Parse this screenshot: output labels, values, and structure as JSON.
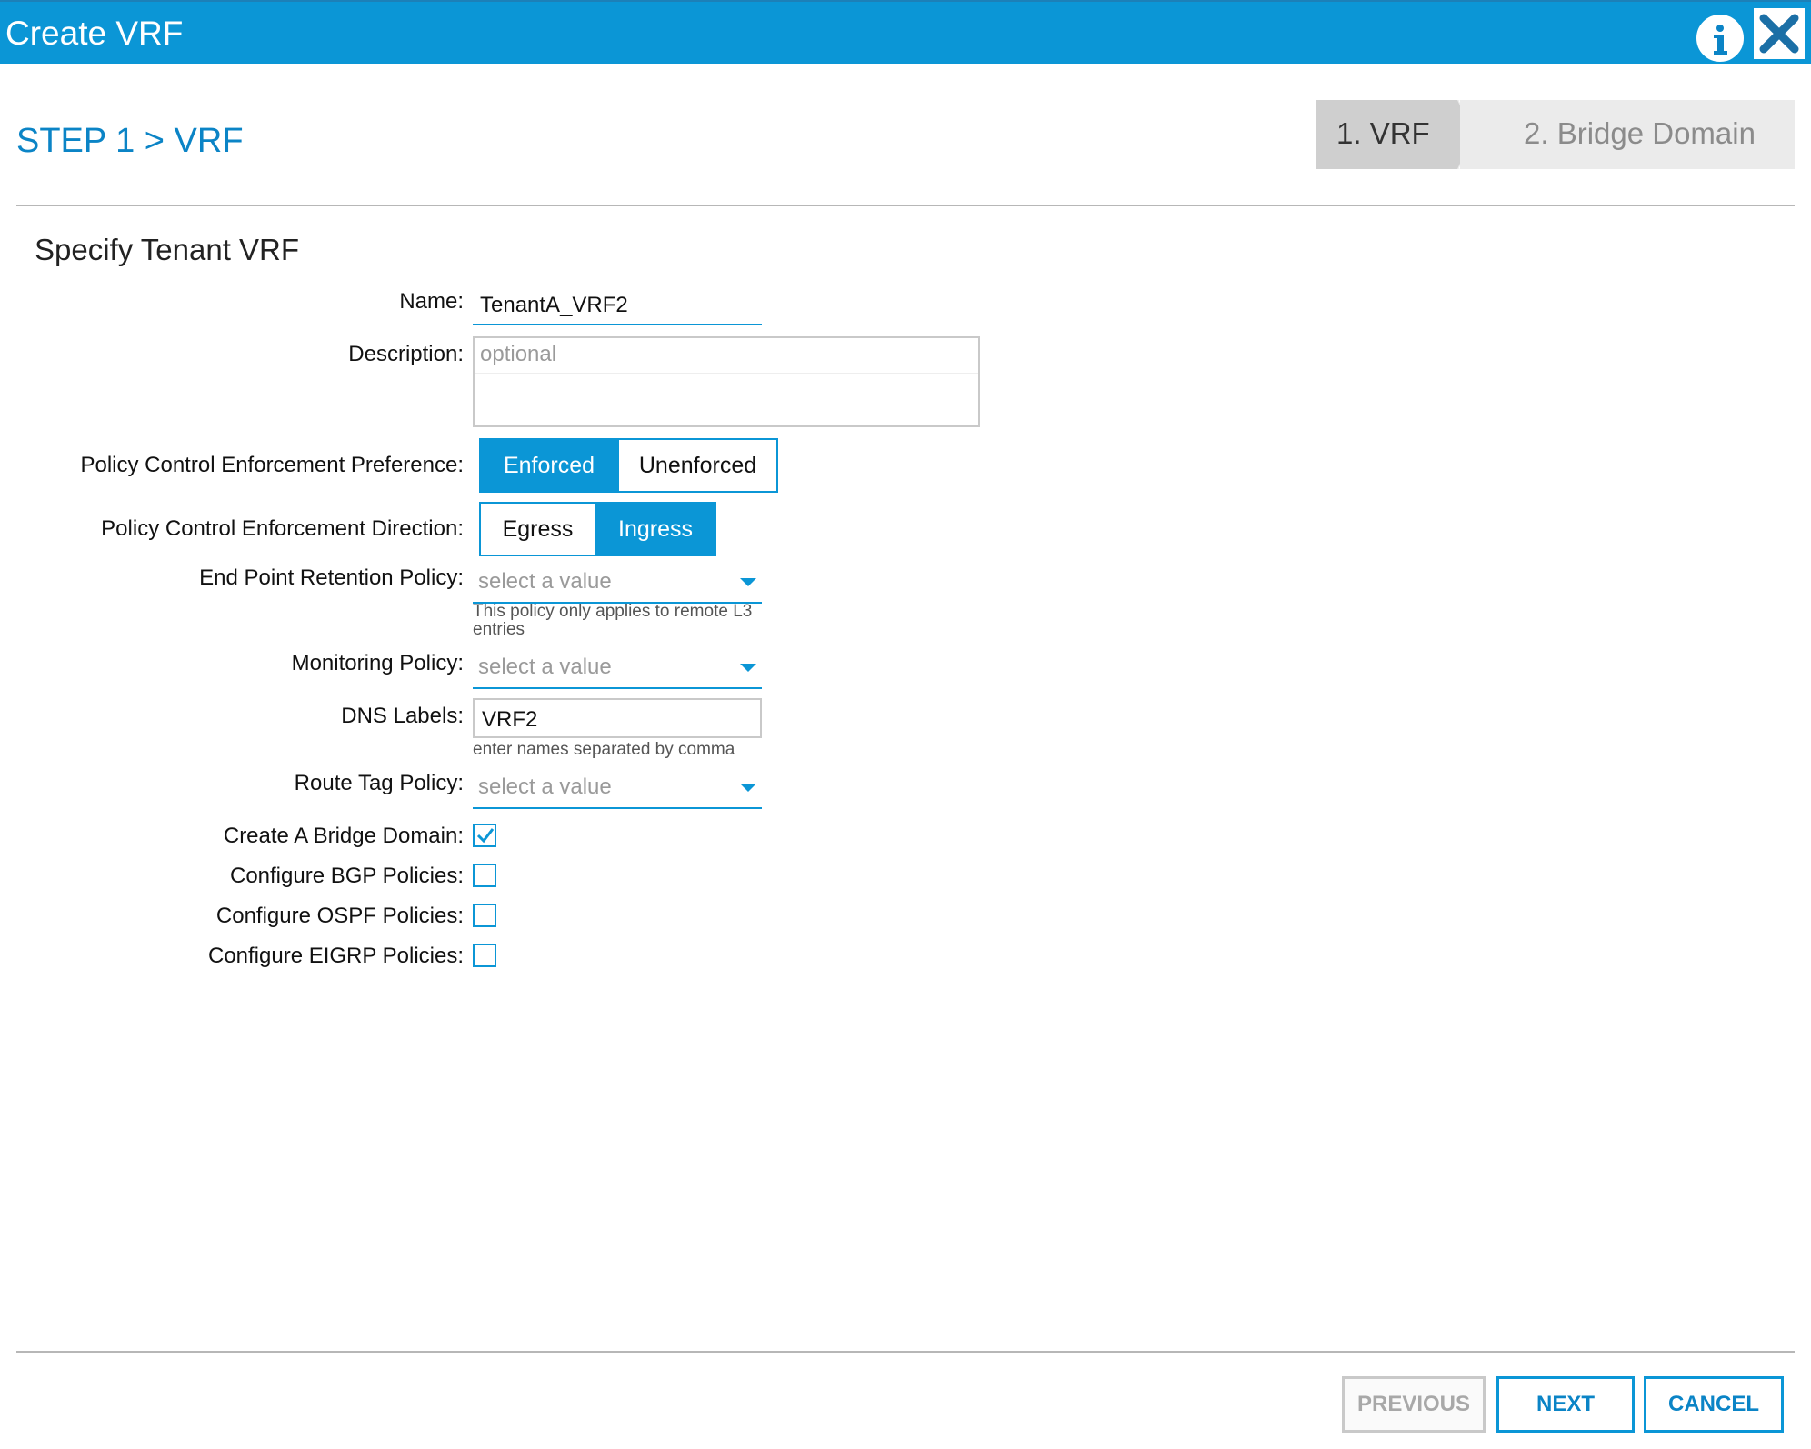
{
  "window": {
    "title": "Create VRF",
    "info_icon": "info-icon",
    "close_icon": "close-icon"
  },
  "step_title": "STEP 1 > VRF",
  "wizard": {
    "steps": [
      {
        "label": "1. VRF",
        "active": true
      },
      {
        "label": "2. Bridge Domain",
        "active": false
      }
    ]
  },
  "section_title": "Specify Tenant VRF",
  "form": {
    "name": {
      "label": "Name:",
      "value": "TenantA_VRF2"
    },
    "description": {
      "label": "Description:",
      "placeholder": "optional"
    },
    "enforcement_preference": {
      "label": "Policy Control Enforcement Preference:",
      "options": [
        "Enforced",
        "Unenforced"
      ],
      "selected": "Enforced"
    },
    "enforcement_direction": {
      "label": "Policy Control Enforcement Direction:",
      "options": [
        "Egress",
        "Ingress"
      ],
      "selected": "Ingress"
    },
    "endpoint_retention": {
      "label": "End Point Retention Policy:",
      "placeholder": "select a value",
      "help": "This policy only applies to remote L3 entries"
    },
    "monitoring": {
      "label": "Monitoring Policy:",
      "placeholder": "select a value"
    },
    "dns_labels": {
      "label": "DNS Labels:",
      "value": "VRF2",
      "help": "enter names separated by comma"
    },
    "route_tag": {
      "label": "Route Tag Policy:",
      "placeholder": "select a value"
    },
    "checkboxes": [
      {
        "label": "Create A Bridge Domain:",
        "checked": true
      },
      {
        "label": "Configure BGP Policies:",
        "checked": false
      },
      {
        "label": "Configure OSPF Policies:",
        "checked": false
      },
      {
        "label": "Configure EIGRP Policies:",
        "checked": false
      }
    ]
  },
  "footer": {
    "previous": "PREVIOUS",
    "next": "NEXT",
    "cancel": "CANCEL"
  },
  "colors": {
    "accent": "#0b96d6",
    "disabled": "#a8a8a8"
  }
}
